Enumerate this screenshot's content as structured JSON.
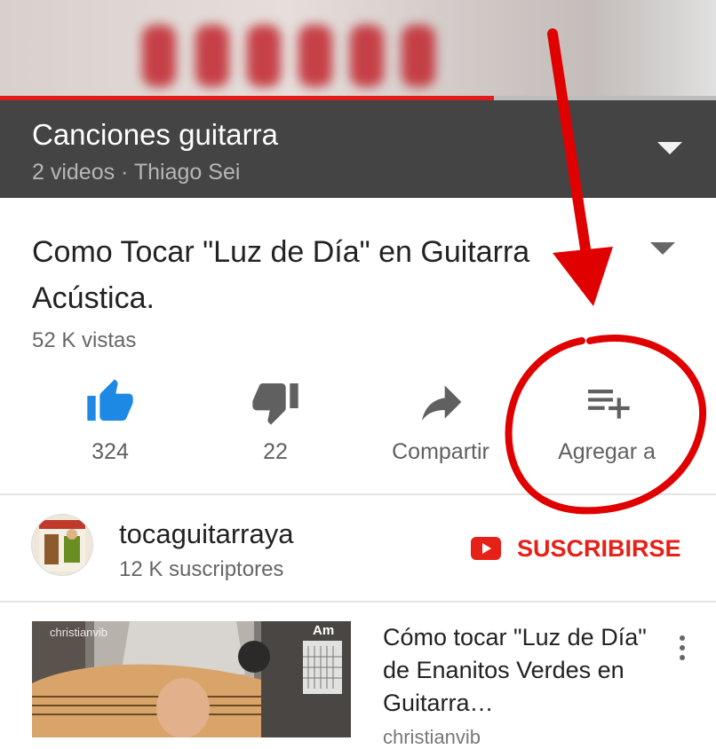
{
  "player": {
    "progress": 0.69
  },
  "playlist": {
    "title": "Canciones guitarra",
    "meta": "2 videos · Thiago Sei"
  },
  "video": {
    "title": "Como Tocar \"Luz de Día\" en Guitarra Acústica.",
    "views": "52 K vistas"
  },
  "actions": {
    "like_count": "324",
    "dislike_count": "22",
    "share_label": "Compartir",
    "add_label": "Agregar a"
  },
  "channel": {
    "name": "tocaguitarraya",
    "subscribers": "12 K suscriptores",
    "subscribe_label": "SUSCRIBIRSE"
  },
  "related": {
    "title": "Cómo tocar \"Luz de Día\" de Enanitos Verdes en Guitarra…",
    "channel": "christianvib",
    "thumb_watermark": "christianvib",
    "chord": "Am"
  },
  "colors": {
    "accent": "#e62117",
    "like": "#1e88e5",
    "playlist_bar": "#444444",
    "annotation": "#e00000"
  },
  "icons": [
    "thumbs-up-icon",
    "thumbs-down-icon",
    "share-icon",
    "playlist-add-icon",
    "youtube-play-icon",
    "more-vert-icon",
    "chevron-down-icon"
  ]
}
